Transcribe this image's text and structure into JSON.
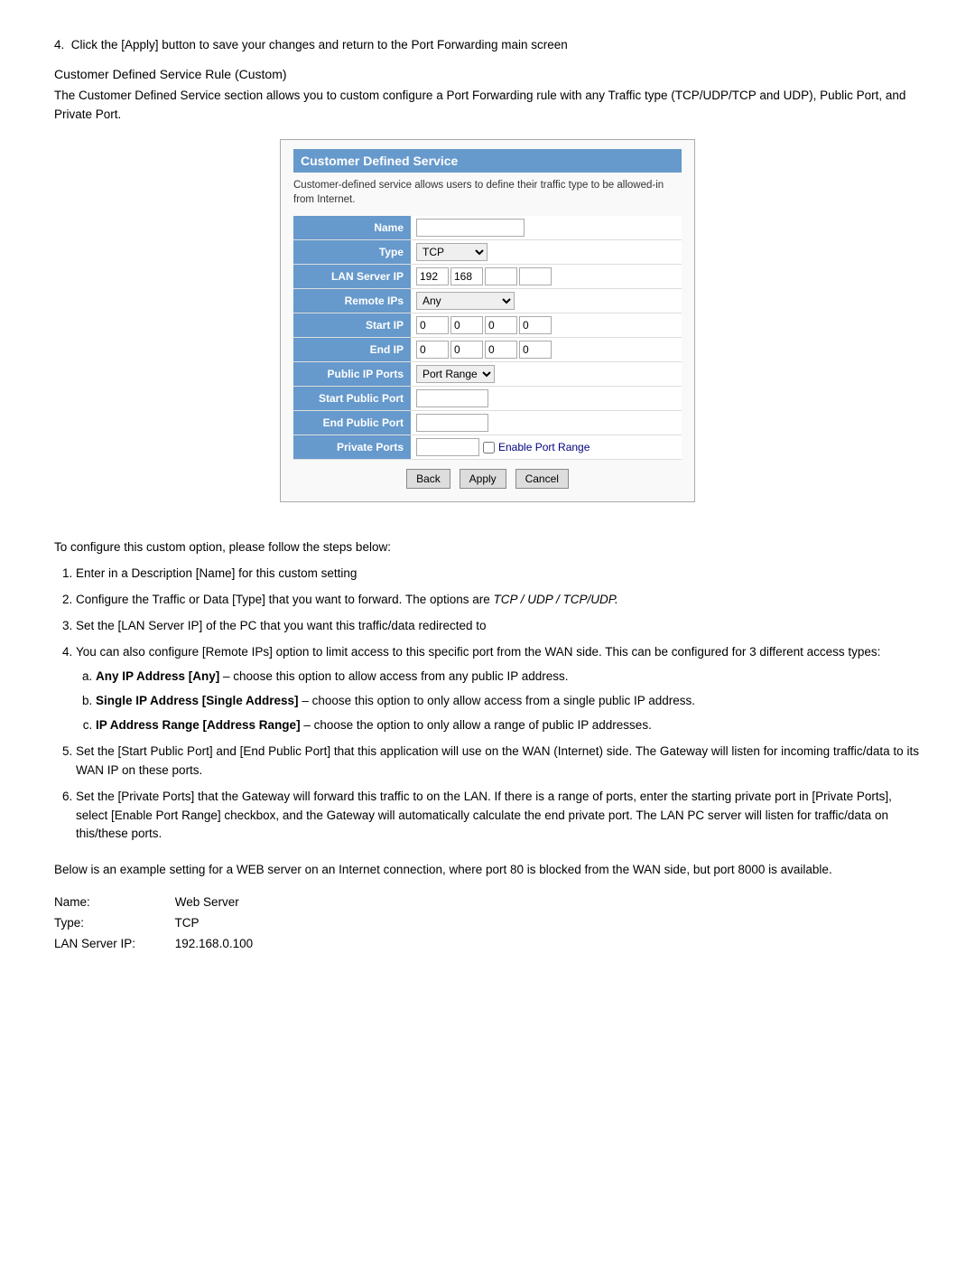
{
  "step4": {
    "text": "Click the [Apply] button to save your changes and return to the Port Forwarding main screen"
  },
  "section_title": "Customer Defined Service Rule (Custom)",
  "section_para": "The Customer Defined Service section allows you to custom configure a Port Forwarding rule with any Traffic type (TCP/UDP/TCP and UDP), Public Port, and Private Port.",
  "form": {
    "title": "Customer Defined Service",
    "desc": "Customer-defined service allows users to define their traffic type to be allowed-in from Internet.",
    "fields": {
      "name_label": "Name",
      "type_label": "Type",
      "type_value": "TCP",
      "lan_server_ip_label": "LAN Server IP",
      "lan_ip1": "192",
      "lan_ip2": "168",
      "remote_ips_label": "Remote IPs",
      "remote_ips_value": "Any",
      "start_ip_label": "Start IP",
      "end_ip_label": "End IP",
      "public_ip_ports_label": "Public IP Ports",
      "public_ip_ports_value": "Port Range",
      "start_public_port_label": "Start Public Port",
      "end_public_port_label": "End Public Port",
      "private_ports_label": "Private Ports",
      "enable_port_range_label": "Enable Port Range"
    },
    "buttons": {
      "back": "Back",
      "apply": "Apply",
      "cancel": "Cancel"
    }
  },
  "configure_intro": "To configure this custom option, please follow the steps below:",
  "steps": [
    {
      "text": "Enter in a Description [Name] for this custom setting"
    },
    {
      "text": "Configure the Traffic or Data [Type] that you want to forward.  The options are TCP / UDP / TCP/UDP.",
      "italic_part": "TCP / UDP /  TCP/UDP."
    },
    {
      "text": "Set the [LAN Server IP] of the PC that you want this traffic/data redirected to"
    },
    {
      "text": "You can also configure [Remote IPs] option to limit access to this specific port from the WAN side. This can be configured for 3 different access types:",
      "sub_steps": [
        {
          "label": "Any IP Address [Any]",
          "text": " – choose this option to allow access from any public IP address."
        },
        {
          "label": "Single IP Address [Single Address]",
          "text": " – choose this option to only allow access from a single public IP address."
        },
        {
          "label": "IP Address Range [Address Range]",
          "text": " – choose the option to only allow a range of public IP addresses."
        }
      ]
    },
    {
      "text": "Set the [Start Public Port] and [End Public Port] that this application will use on the WAN (Internet) side.  The Gateway will listen for incoming traffic/data to its WAN IP on these ports."
    },
    {
      "text": "Set the [Private Ports] that the Gateway will forward this traffic to on the LAN.  If there is a range of ports, enter the starting private port in [Private Ports], select [Enable Port Range] checkbox, and the Gateway will automatically calculate the end private port.  The LAN PC server will listen for traffic/data on this/these ports."
    }
  ],
  "bottom_para": "Below is an example setting for a WEB server on an Internet connection, where port 80 is blocked from the WAN side, but port 8000 is available.",
  "example": {
    "name_label": "Name:",
    "name_value": "Web Server",
    "type_label": "Type:",
    "type_value": "TCP",
    "lan_label": "LAN Server IP:",
    "lan_value": "192.168.0.100"
  }
}
